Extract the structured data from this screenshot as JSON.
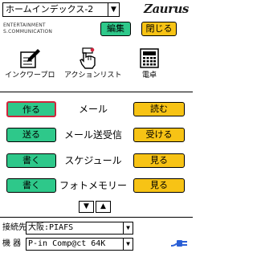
{
  "header": {
    "index_select": "ホームインデックス-2",
    "logo": "Zaurus",
    "edit_label": "編集",
    "close_label": "閉じる"
  },
  "tagline": "ENTERTAINMENT\nS.COMMUNICATION",
  "launchers": [
    {
      "label": "インクワープロ",
      "icon": "pen-paper-icon"
    },
    {
      "label": "アクションリスト",
      "icon": "pointing-hand-icon"
    },
    {
      "label": "電卓",
      "icon": "calculator-icon"
    }
  ],
  "rows": [
    {
      "left": "作る",
      "label": "メール",
      "right": "読む"
    },
    {
      "left": "送る",
      "label": "メール送受信",
      "right": "受ける"
    },
    {
      "left": "書く",
      "label": "スケジュール",
      "right": "見る"
    },
    {
      "left": "書く",
      "label": "フォトメモリー",
      "right": "見る"
    }
  ],
  "pager": {
    "down": "▼",
    "up": "▲"
  },
  "settings": {
    "connection_label": "接続先",
    "connection_value": "大阪:PIAFS",
    "device_label": "機 器",
    "device_value": "P-in Comp@ct 64K"
  },
  "colors": {
    "green": "#2ec88a",
    "yellow": "#f7c315",
    "focus": "#d0243c",
    "plug": "#2a5fd6"
  }
}
